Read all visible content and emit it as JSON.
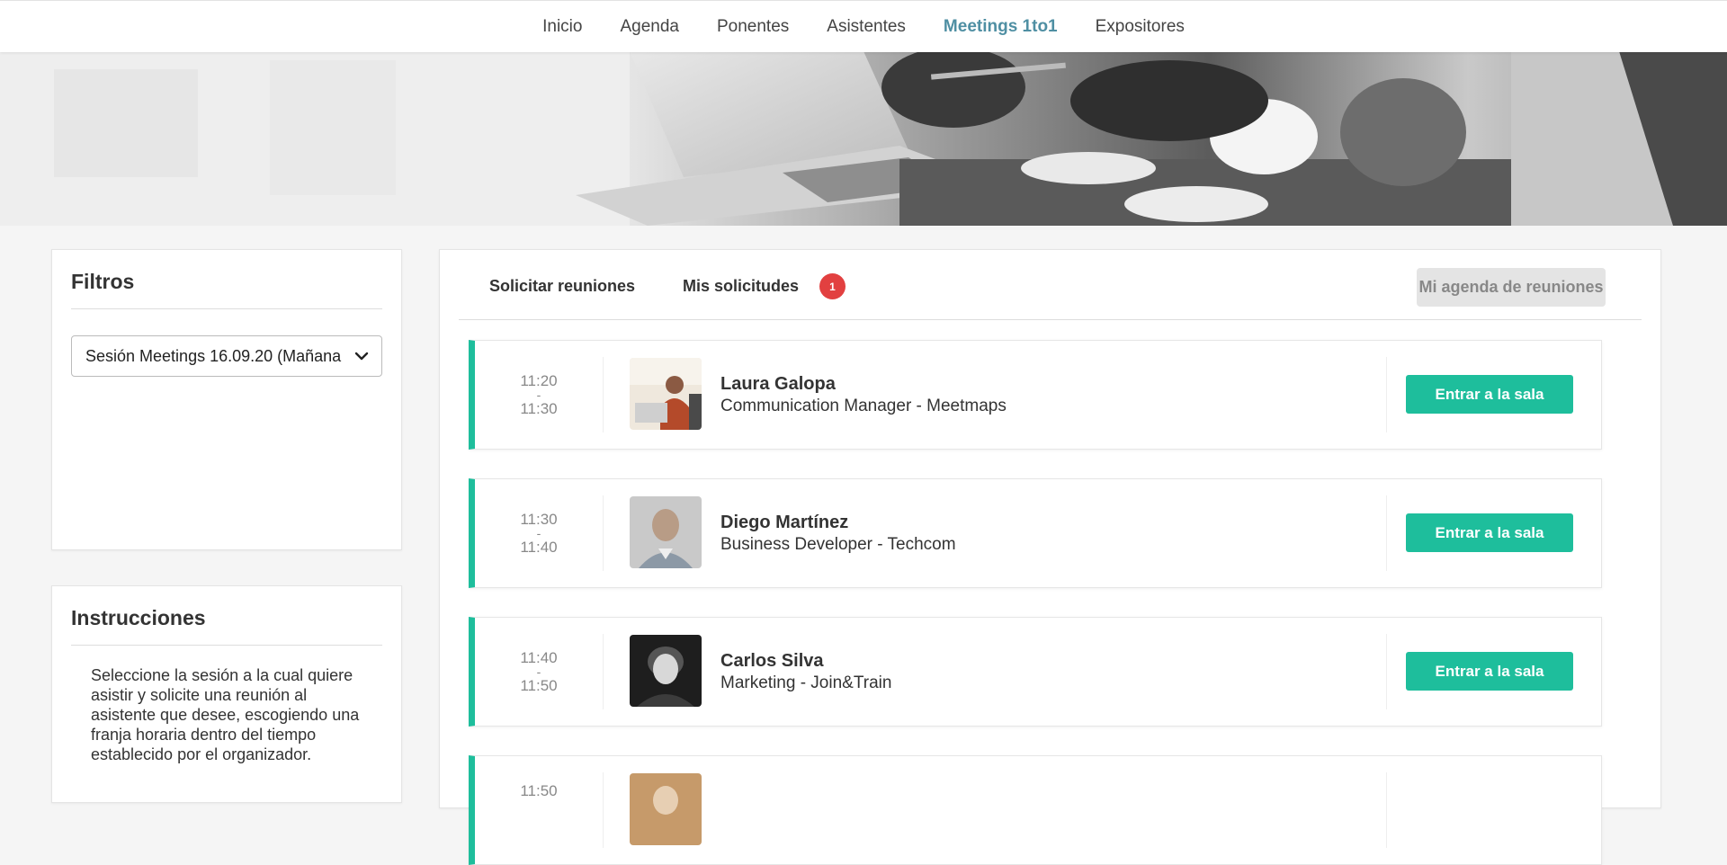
{
  "nav": {
    "items": [
      "Inicio",
      "Agenda",
      "Ponentes",
      "Asistentes",
      "Meetings 1to1",
      "Expositores"
    ],
    "active_index": 4,
    "active_color": "#4f8fa3"
  },
  "filters": {
    "title": "Filtros",
    "session_select_value": "Sesión Meetings 16.09.20 (Mañana"
  },
  "instructions": {
    "title": "Instrucciones",
    "text": "Seleccione la sesión a la cual quiere asistir y solicite una reunión al asistente que desee, escogiendo una franja horaria dentro del tiempo establecido por el organizador."
  },
  "tabs": {
    "request_meetings": "Solicitar reuniones",
    "my_requests": "Mis solicitudes",
    "my_requests_badge": "1",
    "my_agenda_button": "Mi agenda de reuniones"
  },
  "meetings": [
    {
      "start": "11:20",
      "separator": "-",
      "end": "11:30",
      "name": "Laura Galopa",
      "role": "Communication Manager - Meetmaps",
      "button": "Entrar a la sala"
    },
    {
      "start": "11:30",
      "separator": "-",
      "end": "11:40",
      "name": "Diego Martínez",
      "role": "Business Developer - Techcom",
      "button": "Entrar a la sala"
    },
    {
      "start": "11:40",
      "separator": "-",
      "end": "11:50",
      "name": "Carlos Silva",
      "role": "Marketing - Join&Train",
      "button": "Entrar a la sala"
    },
    {
      "start": "11:50",
      "separator": "",
      "end": "",
      "name": "",
      "role": "",
      "button": ""
    }
  ],
  "colors": {
    "accent": "#1ebe9c",
    "badge": "#e24040",
    "nav_active": "#4f8fa3"
  }
}
